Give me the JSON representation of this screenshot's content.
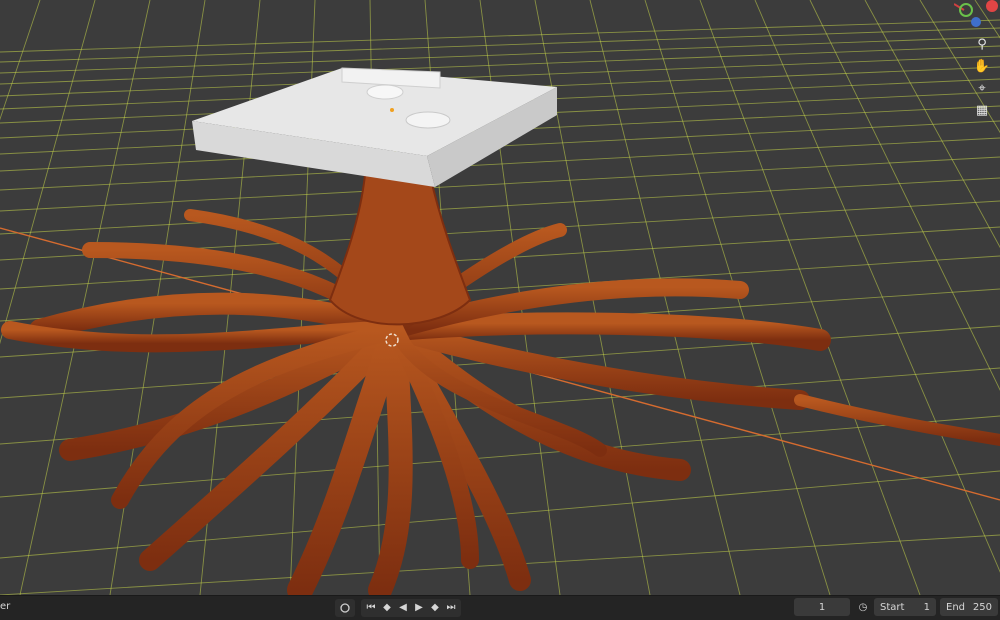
{
  "viewport": {
    "colors": {
      "background": "#3c3c3c",
      "grid_line": "#c7d64a",
      "x_axis": "#d56b2f",
      "root_color": "#8e3a16",
      "root_highlight": "#b8581f",
      "platform_color": "#e7e7e7"
    },
    "nav_icons": [
      "zoom-icon",
      "pan-hand-icon",
      "camera-icon",
      "grid-toggle-icon"
    ]
  },
  "timeline": {
    "left_text": "er",
    "current_frame": "1",
    "start_label": "Start",
    "start_value": "1",
    "end_label": "End",
    "end_value": "250"
  }
}
